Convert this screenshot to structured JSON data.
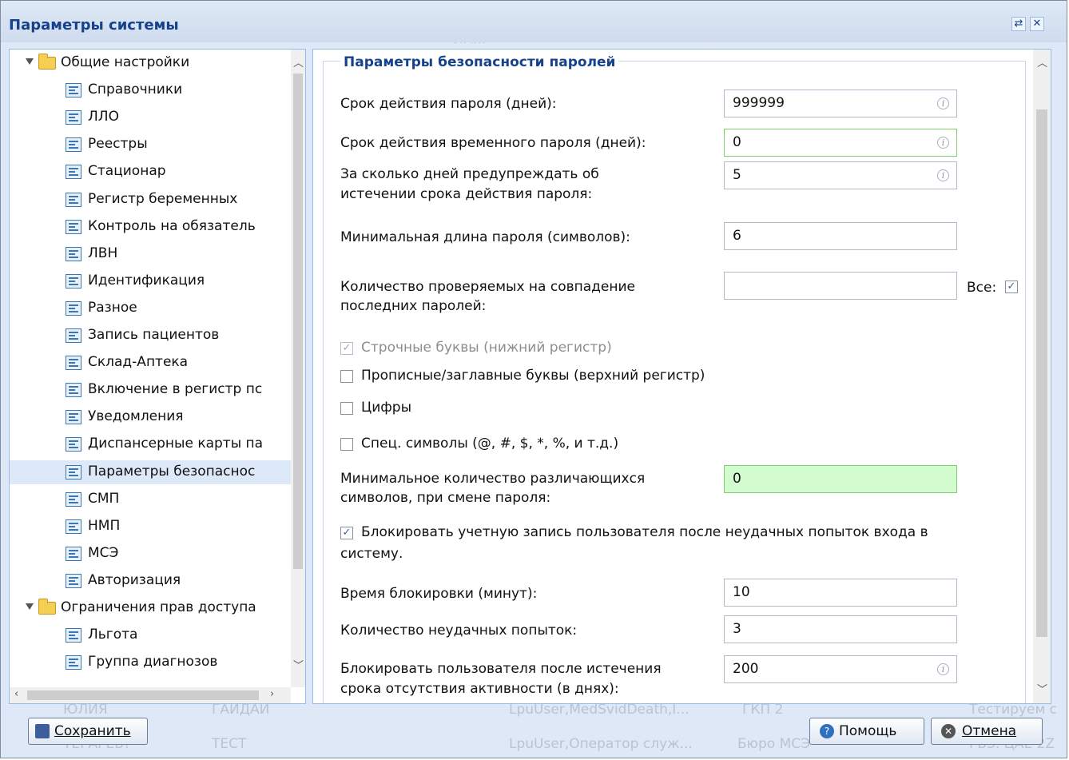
{
  "window": {
    "title": "Параметры системы"
  },
  "background_ghost": {
    "name_label": "Имя:",
    "row1": [
      "ЮЛИЯ",
      "ГАЙДАЙ",
      "LpuUser,MedSvidDeath,I...",
      "ГКП 2",
      "Тестируем с"
    ],
    "row2": [
      "ТЕГАРЕВ?",
      "ТЕСТ",
      "LpuUser,Оператор служ...",
      "Бюро МСЭ",
      "РБЗ. ЦАЕ 2Z"
    ]
  },
  "tree": {
    "items": [
      {
        "label": "Общие настройки",
        "kind": "folder",
        "level": 0
      },
      {
        "label": "Справочники",
        "kind": "leaf",
        "level": 1
      },
      {
        "label": "ЛЛО",
        "kind": "leaf",
        "level": 1
      },
      {
        "label": "Реестры",
        "kind": "leaf",
        "level": 1
      },
      {
        "label": "Стационар",
        "kind": "leaf",
        "level": 1
      },
      {
        "label": "Регистр беременных",
        "kind": "leaf",
        "level": 1
      },
      {
        "label": "Контроль на обязатель",
        "kind": "leaf",
        "level": 1
      },
      {
        "label": "ЛВН",
        "kind": "leaf",
        "level": 1
      },
      {
        "label": "Идентификация",
        "kind": "leaf",
        "level": 1
      },
      {
        "label": "Разное",
        "kind": "leaf",
        "level": 1
      },
      {
        "label": "Запись пациентов",
        "kind": "leaf",
        "level": 1
      },
      {
        "label": "Склад-Аптека",
        "kind": "leaf",
        "level": 1
      },
      {
        "label": "Включение в регистр пс",
        "kind": "leaf",
        "level": 1
      },
      {
        "label": "Уведомления",
        "kind": "leaf",
        "level": 1
      },
      {
        "label": "Диспансерные карты па",
        "kind": "leaf",
        "level": 1
      },
      {
        "label": "Параметры безопаснос",
        "kind": "leaf",
        "level": 1,
        "selected": true
      },
      {
        "label": "СМП",
        "kind": "leaf",
        "level": 1
      },
      {
        "label": "НМП",
        "kind": "leaf",
        "level": 1
      },
      {
        "label": "МСЭ",
        "kind": "leaf",
        "level": 1
      },
      {
        "label": "Авторизация",
        "kind": "leaf",
        "level": 1
      },
      {
        "label": "Ограничения прав доступа",
        "kind": "folder",
        "level": 0
      },
      {
        "label": "Льгота",
        "kind": "leaf",
        "level": 1
      },
      {
        "label": "Группа диагнозов",
        "kind": "leaf",
        "level": 1
      }
    ]
  },
  "form": {
    "legend": "Параметры безопасности паролей",
    "password_expiry_label": "Срок действия пароля (дней):",
    "password_expiry_value": "999999",
    "temp_password_expiry_label": "Срок действия временного пароля (дней):",
    "temp_password_expiry_value": "0",
    "warn_days_label_1": "За сколько дней предупреждать об",
    "warn_days_label_2": "истечении срока действия пароля:",
    "warn_days_value": "5",
    "min_length_label": "Минимальная длина пароля (символов):",
    "min_length_value": "6",
    "history_label_1": "Количество проверяемых на совпадение",
    "history_label_2": "последних паролей:",
    "history_value": "",
    "all_label": "Все:",
    "all_checked": true,
    "lowercase_label": "Строчные буквы (нижний регистр)",
    "lowercase_checked": true,
    "uppercase_label": "Прописные/заглавные буквы (верхний регистр)",
    "uppercase_checked": false,
    "digits_label": "Цифры",
    "digits_checked": false,
    "special_label": "Спец. символы (@, #, $, *, %, и т.д.)",
    "special_checked": false,
    "min_diff_label_1": "Минимальное количество различающихся",
    "min_diff_label_2": "символов, при смене пароля:",
    "min_diff_value": "0",
    "lock_label_1": "Блокировать учетную запись пользователя после неудачных попыток входа в",
    "lock_label_2": "систему.",
    "lock_checked": true,
    "lock_time_label": "Время блокировки (минут):",
    "lock_time_value": "10",
    "failed_attempts_label": "Количество неудачных попыток:",
    "failed_attempts_value": "3",
    "inactive_label_1": "Блокировать пользователя после истечения",
    "inactive_label_2": "срока отсутствия активности (в днях):",
    "inactive_value": "200"
  },
  "buttons": {
    "save": "Сохранить",
    "help": "Помощь",
    "cancel": "Отмена"
  },
  "colors": {
    "title": "#15428b",
    "window_bg": "#dfe8f6",
    "selected_row": "#dde9f8",
    "highlight_input": "#d2fbd0"
  }
}
